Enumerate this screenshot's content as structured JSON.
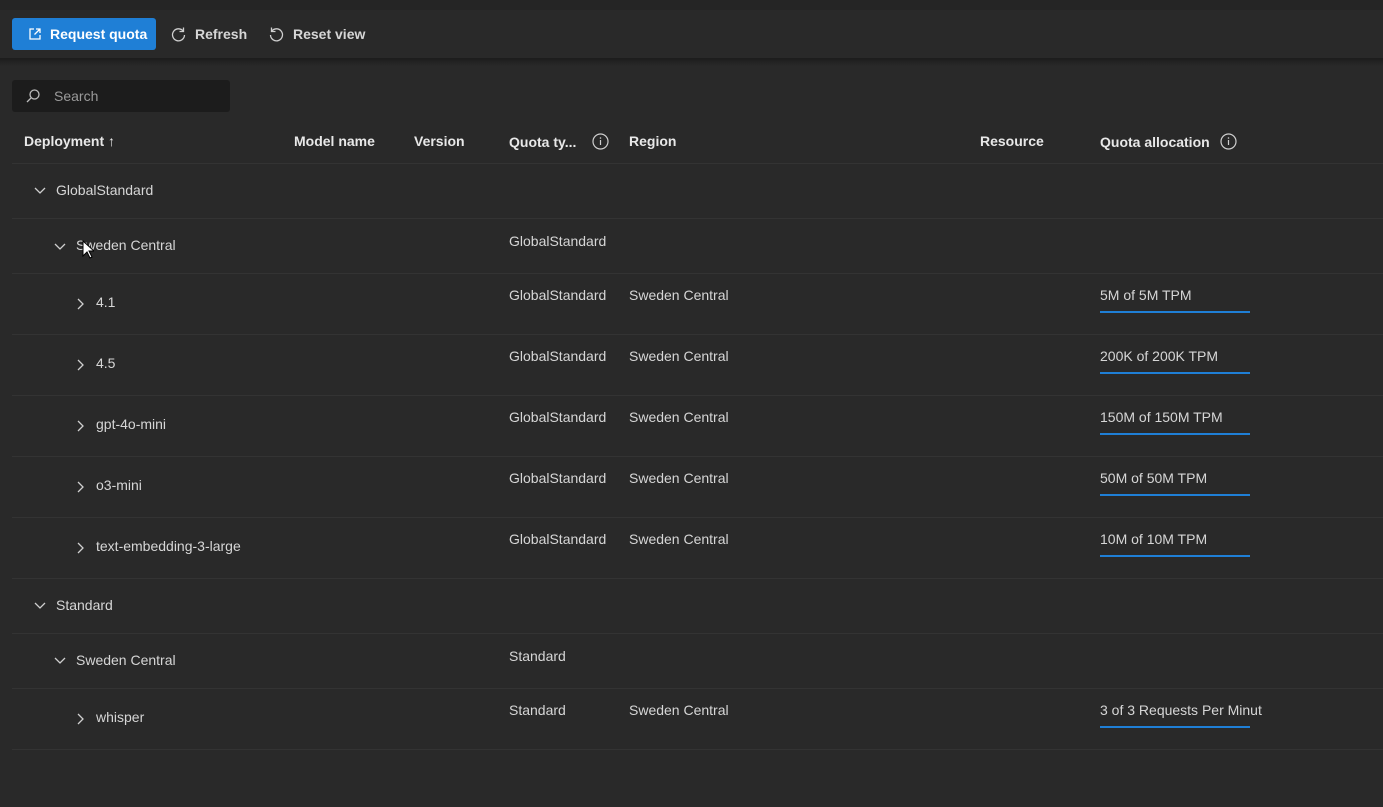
{
  "toolbar": {
    "request_quota": "Request quota",
    "refresh": "Refresh",
    "reset_view": "Reset view"
  },
  "search": {
    "placeholder": "Search"
  },
  "columns": {
    "deployment": "Deployment ↑",
    "model_name": "Model name",
    "version": "Version",
    "quota_type": "Quota ty...",
    "region": "Region",
    "resource": "Resource",
    "quota_allocation": "Quota allocation"
  },
  "groups": {
    "global": {
      "label": "GlobalStandard",
      "region_label": "Sweden Central",
      "region_quota_type": "GlobalStandard",
      "rows": [
        {
          "name": "4.1",
          "quota_type": "GlobalStandard",
          "region": "Sweden Central",
          "allocation": "5M of 5M TPM",
          "fill": 1.0
        },
        {
          "name": "4.5",
          "quota_type": "GlobalStandard",
          "region": "Sweden Central",
          "allocation": "200K of 200K TPM",
          "fill": 1.0
        },
        {
          "name": "gpt-4o-mini",
          "quota_type": "GlobalStandard",
          "region": "Sweden Central",
          "allocation": "150M of 150M TPM",
          "fill": 1.0
        },
        {
          "name": "o3-mini",
          "quota_type": "GlobalStandard",
          "region": "Sweden Central",
          "allocation": "50M of 50M TPM",
          "fill": 1.0
        },
        {
          "name": "text-embedding-3-large",
          "quota_type": "GlobalStandard",
          "region": "Sweden Central",
          "allocation": "10M of 10M TPM",
          "fill": 1.0
        }
      ]
    },
    "standard": {
      "label": "Standard",
      "region_label": "Sweden Central",
      "region_quota_type": "Standard",
      "rows": [
        {
          "name": "whisper",
          "quota_type": "Standard",
          "region": "Sweden Central",
          "allocation": "3 of 3 Requests Per Minut",
          "fill": 1.0
        }
      ]
    }
  },
  "colors": {
    "accent": "#1f7fd6",
    "background": "#292929"
  }
}
